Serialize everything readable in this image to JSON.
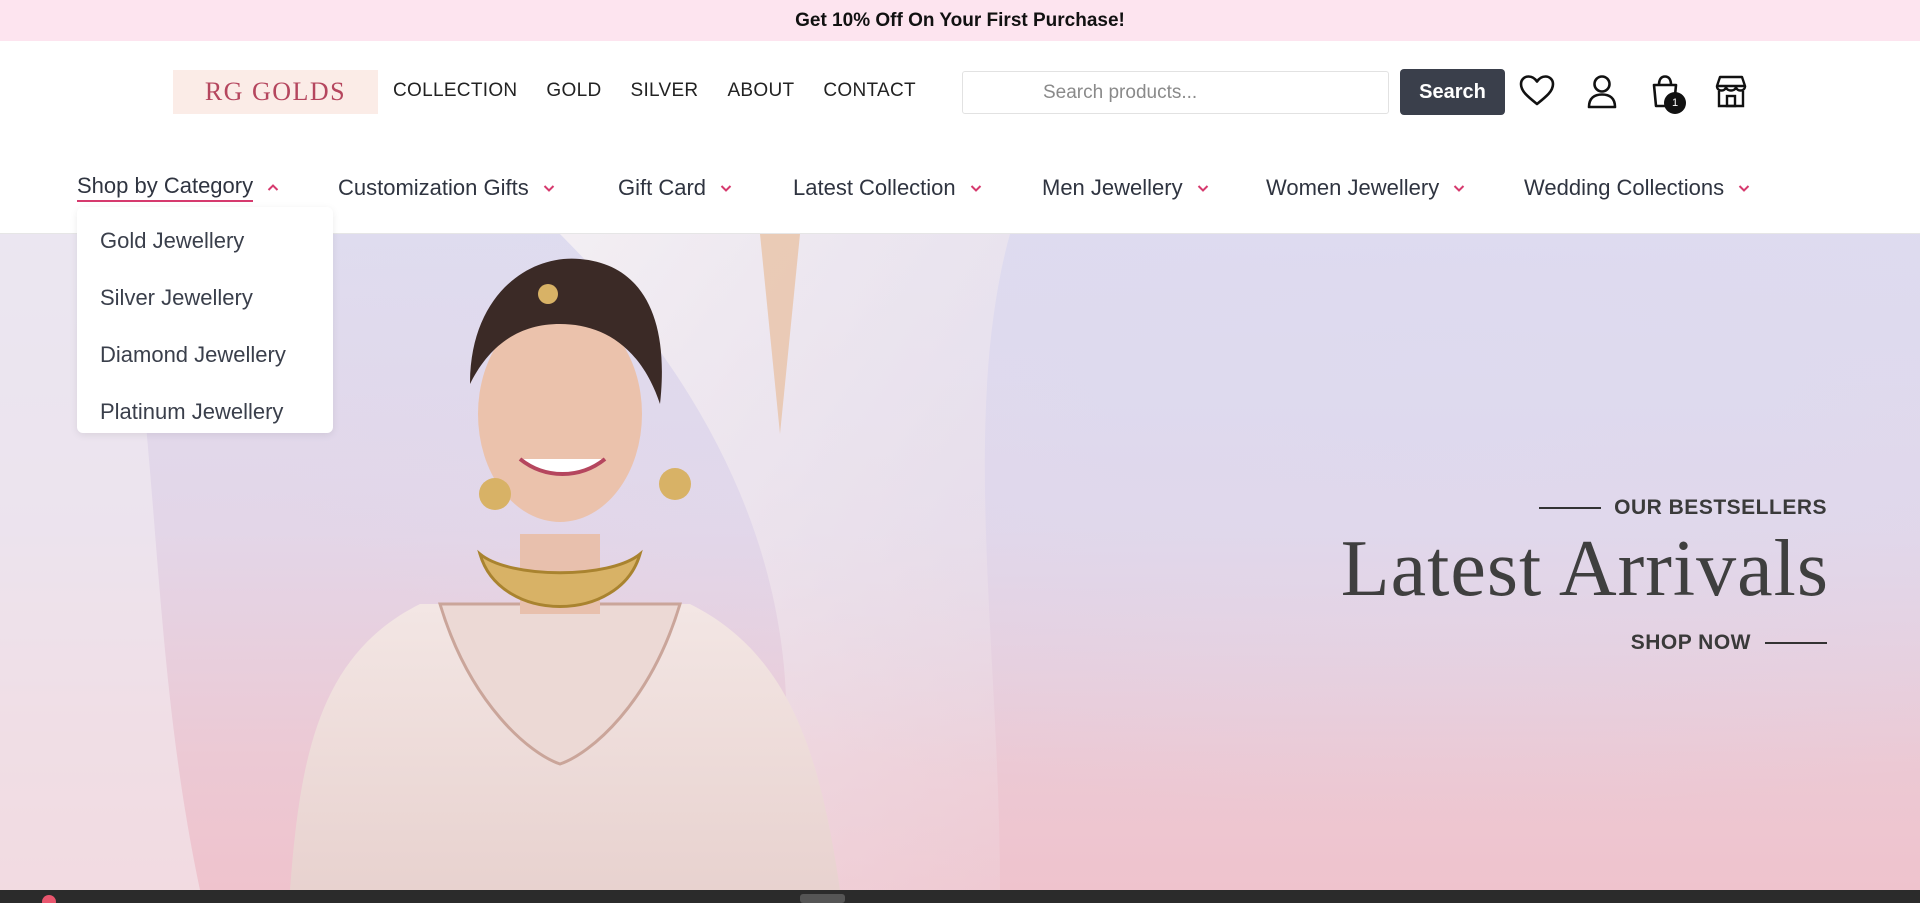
{
  "promo": {
    "text": "Get 10% Off On Your First Purchase!"
  },
  "header": {
    "logo_text": "RG GOLDS",
    "nav": [
      {
        "label": "COLLECTION"
      },
      {
        "label": "GOLD"
      },
      {
        "label": "SILVER"
      },
      {
        "label": "ABOUT"
      },
      {
        "label": "CONTACT"
      }
    ],
    "search": {
      "placeholder": "Search products...",
      "button_label": "Search"
    },
    "icons": [
      "heart-icon",
      "user-icon",
      "shopping-bag-icon",
      "store-icon"
    ],
    "cart_count": "1"
  },
  "categories": {
    "items": [
      {
        "label": "Shop by Category",
        "active": true
      },
      {
        "label": "Customization Gifts"
      },
      {
        "label": "Gift Card"
      },
      {
        "label": "Latest Collection"
      },
      {
        "label": "Men Jewellery"
      },
      {
        "label": "Women Jewellery"
      },
      {
        "label": "Wedding Collections"
      }
    ],
    "dropdown": [
      {
        "label": "Gold Jewellery"
      },
      {
        "label": "Silver Jewellery"
      },
      {
        "label": "Diamond Jewellery"
      },
      {
        "label": "Platinum Jewellery"
      }
    ]
  },
  "hero": {
    "eyebrow": "OUR BESTSELLERS",
    "title": "Latest Arrivals",
    "cta": "SHOP NOW"
  },
  "colors": {
    "promo_bg": "#fde4ef",
    "accent": "#d63a6e",
    "search_button": "#3a3f4b",
    "logo_text": "#b5465e"
  }
}
